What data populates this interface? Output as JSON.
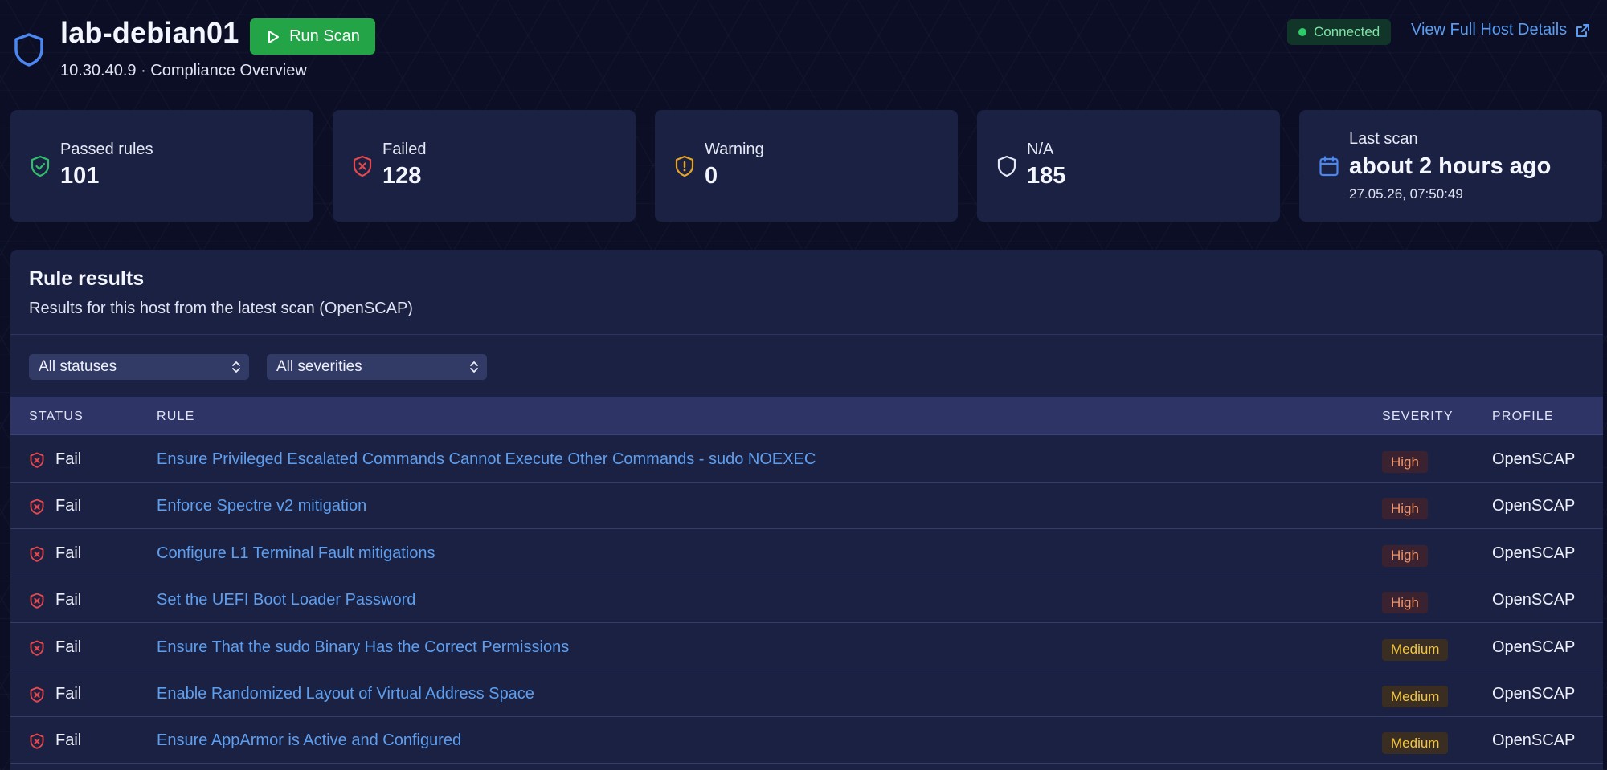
{
  "header": {
    "host_name": "lab-debian01",
    "run_scan_label": "Run Scan",
    "subtitle": "10.30.40.9 · Compliance Overview",
    "status_label": "Connected",
    "host_details_label": "View Full Host Details",
    "status_color": "#2ecc6a",
    "accent_color": "#5b9cf0"
  },
  "stats": [
    {
      "label": "Passed rules",
      "value": "101",
      "icon": "shield-check-icon",
      "color": "#2fbf6a"
    },
    {
      "label": "Failed",
      "value": "128",
      "icon": "shield-x-icon",
      "color": "#e5484d"
    },
    {
      "label": "Warning",
      "value": "0",
      "icon": "shield-alert-icon",
      "color": "#e5a526"
    },
    {
      "label": "N/A",
      "value": "185",
      "icon": "shield-icon",
      "color": "#e6e9f5"
    },
    {
      "label": "Last scan",
      "value": "about 2 hours ago",
      "sub": "27.05.26, 07:50:49",
      "icon": "calendar-icon",
      "color": "#4c86f0"
    }
  ],
  "results": {
    "title": "Rule results",
    "description": "Results for this host from the latest scan (OpenSCAP)",
    "filters": {
      "status": "All statuses",
      "severity": "All severities"
    },
    "columns": [
      "STATUS",
      "RULE",
      "SEVERITY",
      "PROFILE"
    ],
    "rows": [
      {
        "status": "Fail",
        "rule": "Ensure Privileged Escalated Commands Cannot Execute Other Commands - sudo NOEXEC",
        "severity": "High",
        "profile": "OpenSCAP"
      },
      {
        "status": "Fail",
        "rule": "Enforce Spectre v2 mitigation",
        "severity": "High",
        "profile": "OpenSCAP"
      },
      {
        "status": "Fail",
        "rule": "Configure L1 Terminal Fault mitigations",
        "severity": "High",
        "profile": "OpenSCAP"
      },
      {
        "status": "Fail",
        "rule": "Set the UEFI Boot Loader Password",
        "severity": "High",
        "profile": "OpenSCAP"
      },
      {
        "status": "Fail",
        "rule": "Ensure That the sudo Binary Has the Correct Permissions",
        "severity": "Medium",
        "profile": "OpenSCAP"
      },
      {
        "status": "Fail",
        "rule": "Enable Randomized Layout of Virtual Address Space",
        "severity": "Medium",
        "profile": "OpenSCAP"
      },
      {
        "status": "Fail",
        "rule": "Ensure AppArmor is Active and Configured",
        "severity": "Medium",
        "profile": "OpenSCAP"
      }
    ]
  }
}
